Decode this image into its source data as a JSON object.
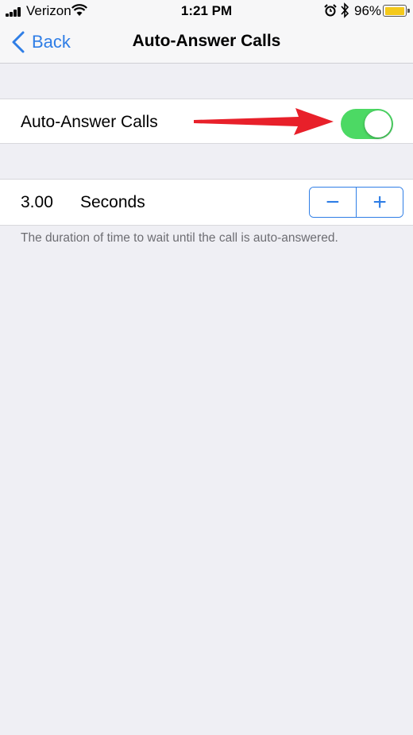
{
  "status_bar": {
    "carrier": "Verizon",
    "time": "1:21 PM",
    "battery_percent": "96%",
    "battery_level": 0.96,
    "icons": [
      "signal-bars-icon",
      "wifi-icon",
      "alarm-icon",
      "bluetooth-icon",
      "battery-icon"
    ]
  },
  "nav": {
    "back_label": "Back",
    "title": "Auto-Answer Calls"
  },
  "toggle_row": {
    "label": "Auto-Answer Calls",
    "enabled": true,
    "on_color": "#4cd964"
  },
  "duration_row": {
    "value": "3.00",
    "unit": "Seconds",
    "decrement_symbol": "−",
    "increment_symbol": "+"
  },
  "footer": {
    "text": "The duration of time to wait until the call is auto-answered."
  },
  "colors": {
    "accent": "#2f7ee6",
    "annotation_arrow": "#e8202a",
    "background": "#efeff4"
  }
}
